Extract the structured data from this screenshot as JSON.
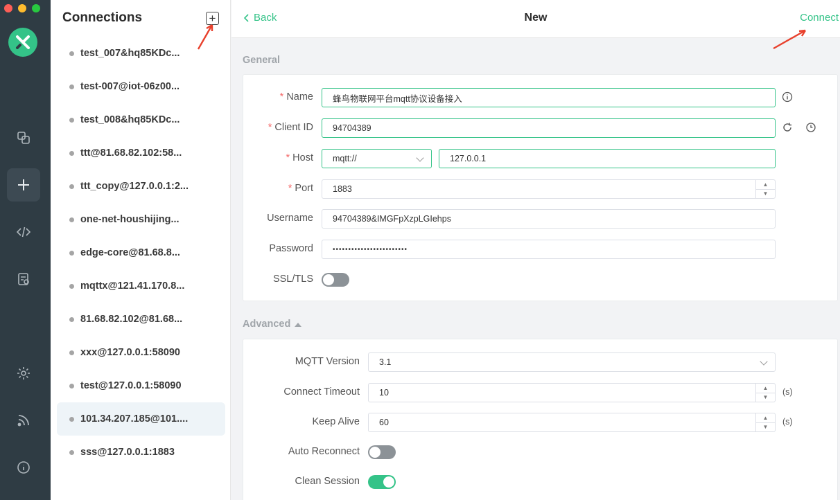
{
  "colors": {
    "accent": "#34c388",
    "required": "#f56c6c",
    "rail_bg": "#2f3c44"
  },
  "sidebar": {
    "title": "Connections",
    "add_icon": "plus-square-icon",
    "connections": [
      {
        "name": "test_007&hq85KDc..."
      },
      {
        "name": "test-007@iot-06z00..."
      },
      {
        "name": "test_008&hq85KDc..."
      },
      {
        "name": "ttt@81.68.82.102:58..."
      },
      {
        "name": "ttt_copy@127.0.0.1:2..."
      },
      {
        "name": "one-net-houshijing..."
      },
      {
        "name": "edge-core@81.68.8..."
      },
      {
        "name": "mqttx@121.41.170.8..."
      },
      {
        "name": "81.68.82.102@81.68..."
      },
      {
        "name": "xxx@127.0.0.1:58090"
      },
      {
        "name": "test@127.0.0.1:58090"
      },
      {
        "name": "101.34.207.185@101...."
      },
      {
        "name": "sss@127.0.0.1:1883"
      }
    ],
    "selected_index": 11
  },
  "header": {
    "back_label": "Back",
    "title": "New",
    "connect_label": "Connect"
  },
  "general": {
    "section_label": "General",
    "name": {
      "label": "Name",
      "value": "蜂鸟物联网平台mqtt协议设备接入"
    },
    "client_id": {
      "label": "Client ID",
      "value": "94704389"
    },
    "host": {
      "label": "Host",
      "protocol": "mqtt://",
      "value": "127.0.0.1"
    },
    "port": {
      "label": "Port",
      "value": "1883"
    },
    "username": {
      "label": "Username",
      "value": "94704389&IMGFpXzpLGIehps"
    },
    "password": {
      "label": "Password",
      "value": "••••••••••••••••••••••••"
    },
    "ssl": {
      "label": "SSL/TLS",
      "enabled": false
    }
  },
  "advanced": {
    "section_label": "Advanced",
    "mqtt_version": {
      "label": "MQTT Version",
      "value": "3.1"
    },
    "connect_timeout": {
      "label": "Connect Timeout",
      "value": "10",
      "unit": "(s)"
    },
    "keep_alive": {
      "label": "Keep Alive",
      "value": "60",
      "unit": "(s)"
    },
    "auto_reconnect": {
      "label": "Auto Reconnect",
      "enabled": false
    },
    "clean_session": {
      "label": "Clean Session",
      "enabled": true
    }
  }
}
